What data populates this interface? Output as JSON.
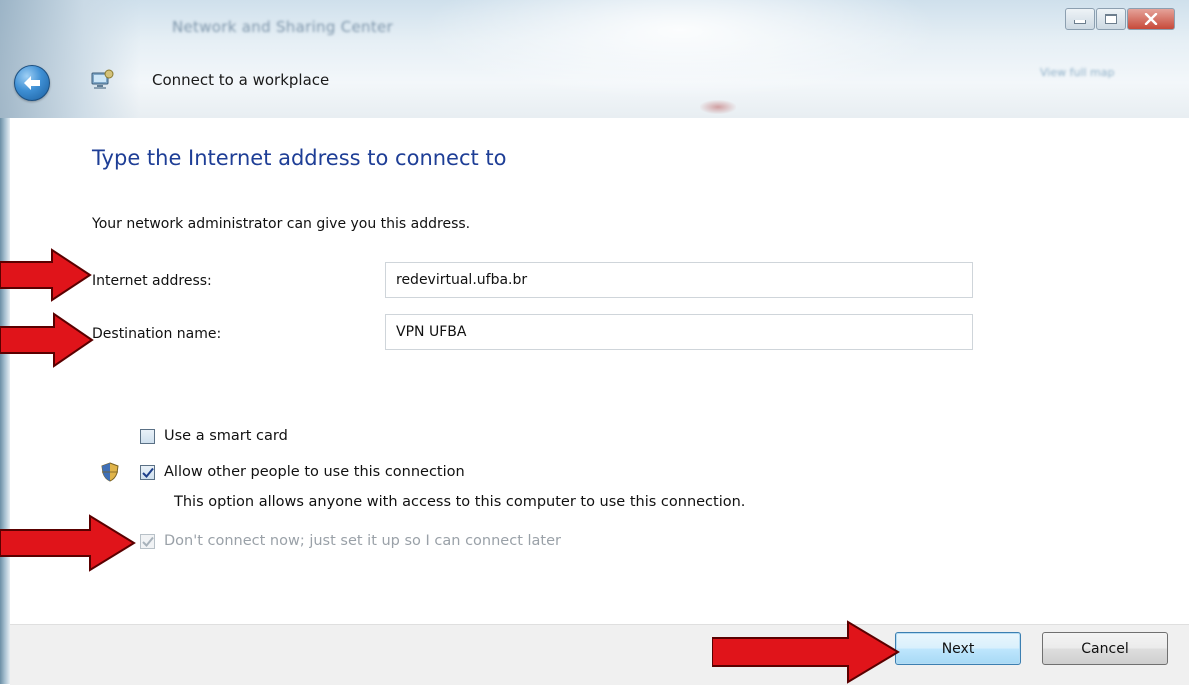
{
  "window": {
    "background_title": "Network and Sharing Center",
    "background_link": "View full map",
    "wizard_title": "Connect to a workplace"
  },
  "page": {
    "heading": "Type the Internet address to connect to",
    "subtext": "Your network administrator can give you this address."
  },
  "form": {
    "internet_address_label": "Internet address:",
    "internet_address_value": "redevirtual.ufba.br",
    "destination_name_label": "Destination name:",
    "destination_name_value": "VPN UFBA"
  },
  "options": {
    "smart_card_label": "Use a smart card",
    "smart_card_checked": false,
    "allow_others_label": "Allow other people to use this connection",
    "allow_others_checked": true,
    "allow_others_desc": "This option allows anyone with access to this computer to use this connection.",
    "dont_connect_label": "Don't connect now; just set it up so I can connect later",
    "dont_connect_checked": true,
    "dont_connect_disabled": true
  },
  "buttons": {
    "next_label": "Next",
    "cancel_label": "Cancel"
  },
  "colors": {
    "heading": "#1e3e96",
    "annotation_arrow": "#e0141a"
  },
  "icons": {
    "back": "back-arrow-icon",
    "app": "network-workplace-icon",
    "shield": "uac-shield-icon",
    "checkmark": "checkmark-icon"
  }
}
